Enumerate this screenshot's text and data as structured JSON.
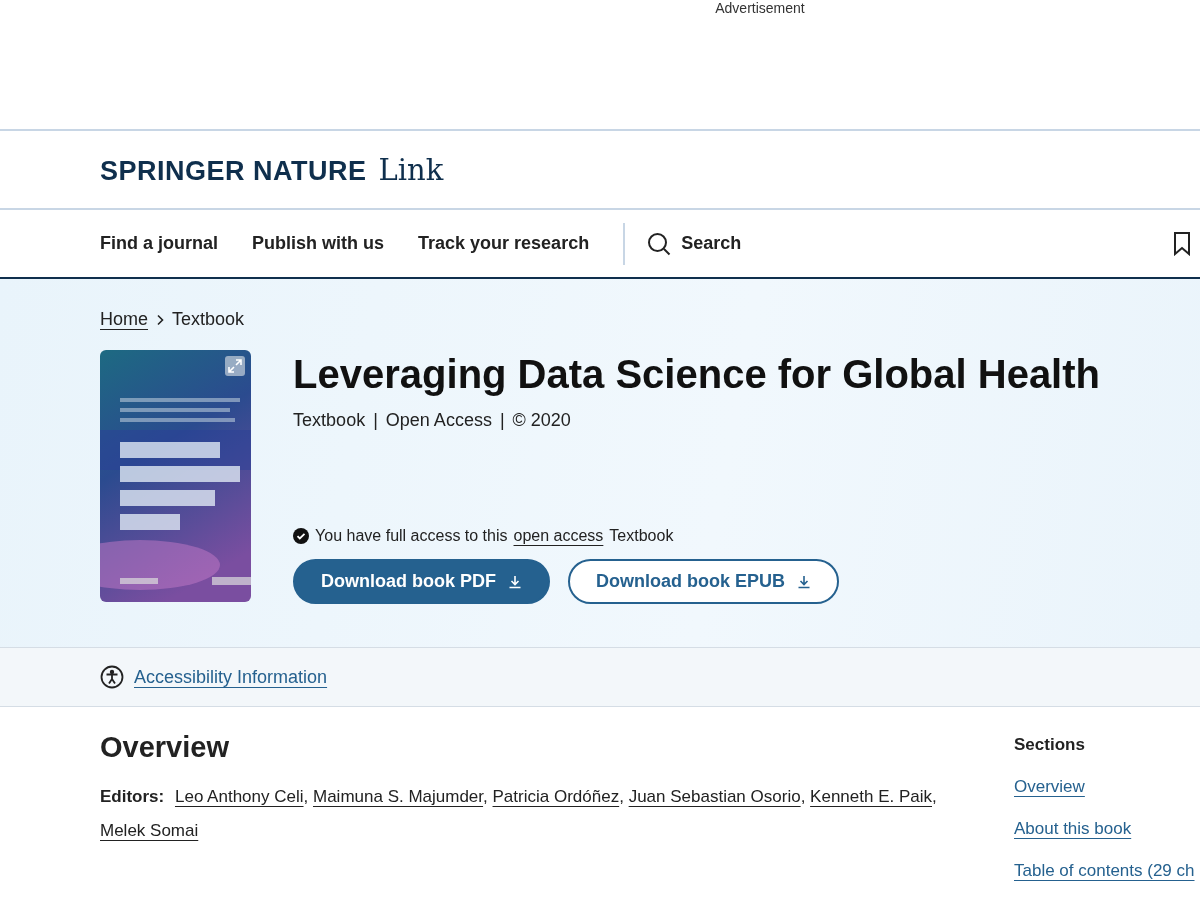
{
  "advert": {
    "label": "Advertisement"
  },
  "brand": {
    "name": "SPRINGER NATURE",
    "product": "Link"
  },
  "nav": {
    "items": [
      "Find a journal",
      "Publish with us",
      "Track your research"
    ],
    "search": "Search"
  },
  "breadcrumb": [
    {
      "label": "Home",
      "link": true
    },
    {
      "label": "Textbook",
      "link": false
    }
  ],
  "book": {
    "title": "Leveraging Data Science for Global Health",
    "meta": [
      "Textbook",
      "Open Access",
      "© 2020"
    ],
    "meta_separator": "|",
    "access": {
      "before": "You have full access to this",
      "link": "open access",
      "after": "Textbook"
    },
    "buttons": [
      {
        "label": "Download book PDF",
        "kind": "primary"
      },
      {
        "label": "Download book EPUB",
        "kind": "secondary"
      }
    ]
  },
  "accessibility": {
    "label": "Accessibility Information"
  },
  "overview": {
    "heading": "Overview",
    "editors_label": "Editors:",
    "editor_separator": ",",
    "editors": [
      "Leo Anthony Celi",
      "Maimuna S. Majumder",
      "Patricia Ordóñez",
      "Juan Sebastian Osorio",
      "Kenneth E. Paik",
      "Melek Somai"
    ]
  },
  "sections": {
    "heading": "Sections",
    "items": [
      "Overview",
      "About this book",
      "Table of contents (29 ch"
    ]
  }
}
